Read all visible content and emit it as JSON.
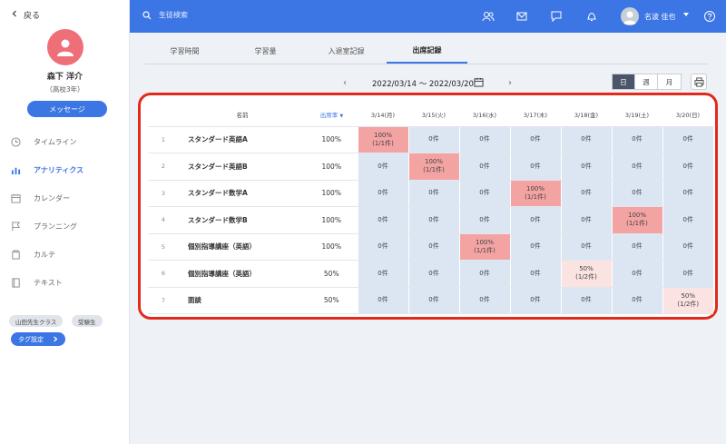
{
  "sidebar": {
    "back_label": "戻る",
    "student_name": "森下 洋介",
    "student_grade": "（高校3年）",
    "message_button": "メッセージ",
    "nav": [
      {
        "label": "タイムライン",
        "icon": "clock-icon",
        "active": false
      },
      {
        "label": "アナリティクス",
        "icon": "bar-chart-icon",
        "active": true
      },
      {
        "label": "カレンダー",
        "icon": "calendar-icon",
        "active": false
      },
      {
        "label": "プランニング",
        "icon": "flag-icon",
        "active": false
      },
      {
        "label": "カルテ",
        "icon": "clipboard-icon",
        "active": false
      },
      {
        "label": "テキスト",
        "icon": "book-icon",
        "active": false
      }
    ],
    "tags": [
      "山田先生クラス",
      "受験生"
    ],
    "tag_settings_button": "タグ設定"
  },
  "header": {
    "search_placeholder": "生徒検索",
    "user_name": "名波 佳也",
    "icons": [
      "users-icon",
      "mail-icon",
      "chat-icon",
      "bell-icon",
      "help-icon"
    ]
  },
  "tabs": [
    "学習時間",
    "学習量",
    "入退室記録",
    "出席記録"
  ],
  "active_tab": "出席記録",
  "date_nav": {
    "range": "2022/03/14 〜 2022/03/20",
    "period_options": [
      "日",
      "週",
      "月"
    ],
    "selected_period": "日"
  },
  "table": {
    "headers": {
      "name": "名前",
      "rate": "出席率"
    },
    "days": [
      "3/14(月)",
      "3/15(火)",
      "3/16(水)",
      "3/17(木)",
      "3/18(金)",
      "3/19(土)",
      "3/20(日)"
    ],
    "rows": [
      {
        "num": "1",
        "name": "スタンダード英語A",
        "rate": "100%",
        "cells": [
          "100%\n(1/1件)",
          "0件",
          "0件",
          "0件",
          "0件",
          "0件",
          "0件"
        ],
        "levels": [
          "hi",
          "",
          "",
          "",
          "",
          "",
          ""
        ]
      },
      {
        "num": "2",
        "name": "スタンダード英語B",
        "rate": "100%",
        "cells": [
          "0件",
          "100%\n(1/1件)",
          "0件",
          "0件",
          "0件",
          "0件",
          "0件"
        ],
        "levels": [
          "",
          "hi",
          "",
          "",
          "",
          "",
          ""
        ]
      },
      {
        "num": "3",
        "name": "スタンダード数学A",
        "rate": "100%",
        "cells": [
          "0件",
          "0件",
          "0件",
          "100%\n(1/1件)",
          "0件",
          "0件",
          "0件"
        ],
        "levels": [
          "",
          "",
          "",
          "hi",
          "",
          "",
          ""
        ]
      },
      {
        "num": "4",
        "name": "スタンダード数学B",
        "rate": "100%",
        "cells": [
          "0件",
          "0件",
          "0件",
          "0件",
          "0件",
          "100%\n(1/1件)",
          "0件"
        ],
        "levels": [
          "",
          "",
          "",
          "",
          "",
          "hi",
          ""
        ]
      },
      {
        "num": "5",
        "name": "個別指導講座（英語）",
        "rate": "100%",
        "cells": [
          "0件",
          "0件",
          "100%\n(1/1件)",
          "0件",
          "0件",
          "0件",
          "0件"
        ],
        "levels": [
          "",
          "",
          "hi",
          "",
          "",
          "",
          ""
        ]
      },
      {
        "num": "6",
        "name": "個別指導講座（英語）",
        "rate": "50%",
        "cells": [
          "0件",
          "0件",
          "0件",
          "0件",
          "50%\n(1/2件)",
          "0件",
          "0件"
        ],
        "levels": [
          "",
          "",
          "",
          "",
          "mid",
          "",
          ""
        ]
      },
      {
        "num": "7",
        "name": "面談",
        "rate": "50%",
        "cells": [
          "0件",
          "0件",
          "0件",
          "0件",
          "0件",
          "0件",
          "50%\n(1/2件)"
        ],
        "levels": [
          "",
          "",
          "",
          "",
          "",
          "",
          "mid"
        ]
      }
    ]
  },
  "colors": {
    "accent": "#3c76e4",
    "highlight_full": "#f4a3a3",
    "highlight_half": "#fae3e1",
    "cell_bg": "#dce6f3",
    "annotation": "#e32a1a"
  }
}
